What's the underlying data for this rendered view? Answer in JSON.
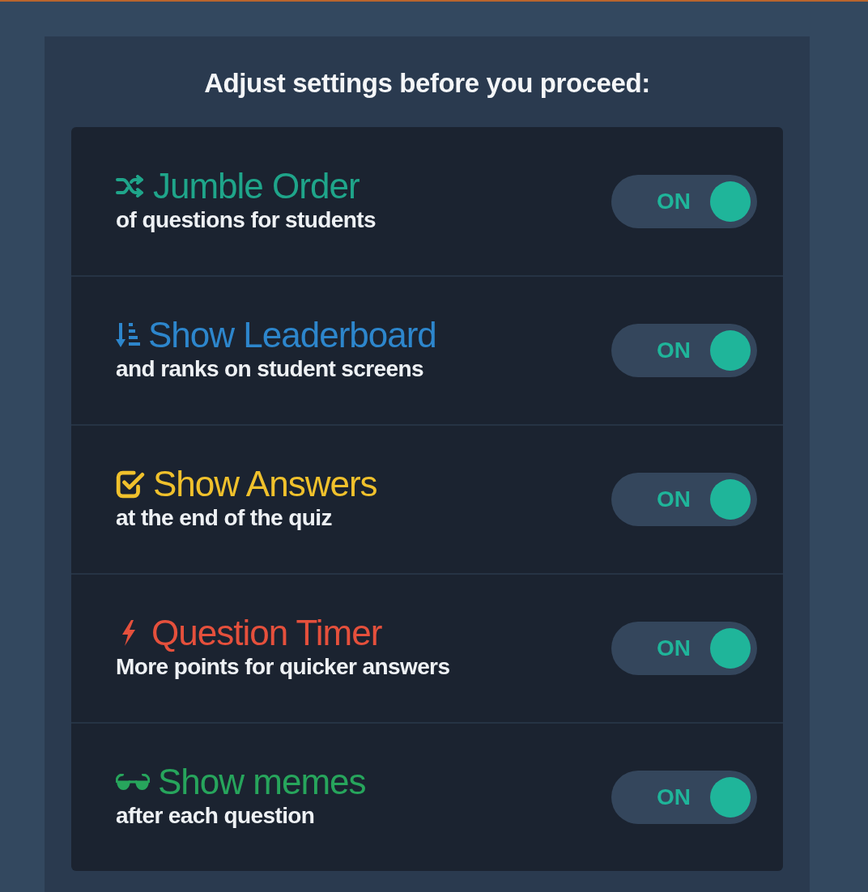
{
  "heading": "Adjust settings before you proceed:",
  "settings": [
    {
      "kind": "jumble",
      "title": "Jumble Order",
      "subtitle": "of questions for students",
      "color": "#1fa58a",
      "toggle": {
        "label": "ON",
        "on": true
      }
    },
    {
      "kind": "leaderboard",
      "title": "Show Leaderboard",
      "subtitle": "and ranks on student screens",
      "color": "#2d86cc",
      "toggle": {
        "label": "ON",
        "on": true
      }
    },
    {
      "kind": "answers",
      "title": "Show Answers",
      "subtitle": "at the end of the quiz",
      "color": "#f0c12c",
      "toggle": {
        "label": "ON",
        "on": true
      }
    },
    {
      "kind": "timer",
      "title": "Question Timer",
      "subtitle": "More points for quicker answers",
      "color": "#e5503c",
      "toggle": {
        "label": "ON",
        "on": true
      }
    },
    {
      "kind": "memes",
      "title": "Show memes",
      "subtitle": "after each question",
      "color": "#27a55c",
      "toggle": {
        "label": "ON",
        "on": true
      }
    }
  ]
}
